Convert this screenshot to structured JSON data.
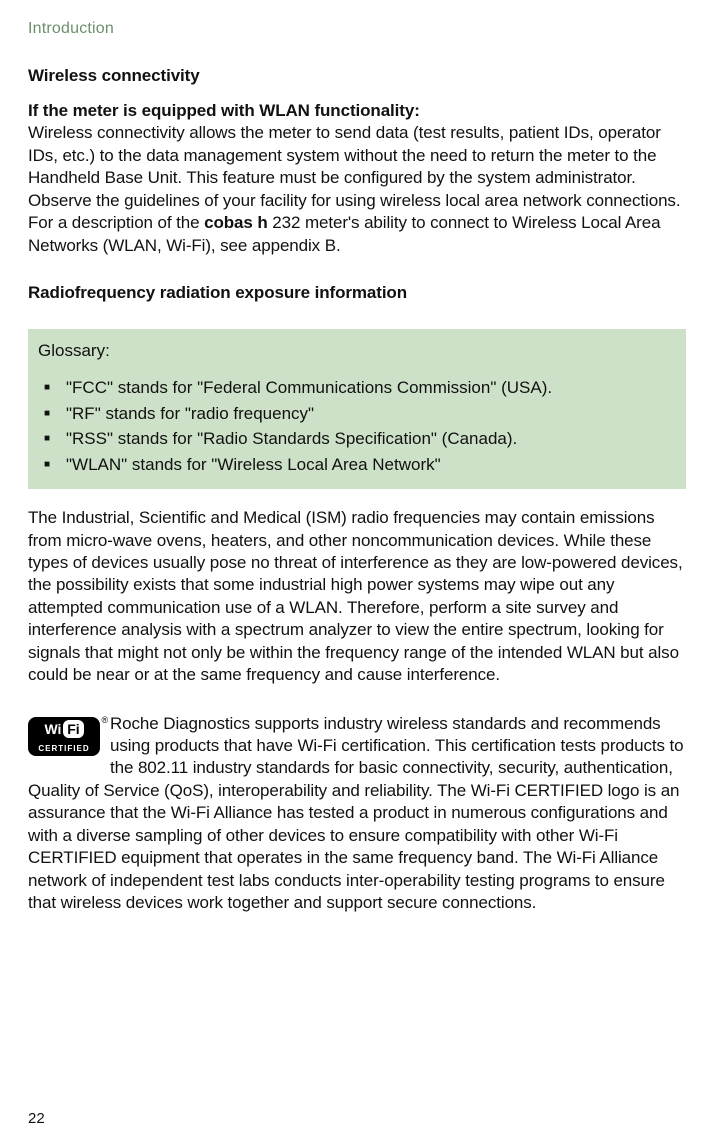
{
  "header": "Introduction",
  "section1_title": "Wireless connectivity",
  "section1_lead": "If the meter is equipped with WLAN functionality:",
  "section1_body_a": "Wireless connectivity allows the meter to send data (test results, patient IDs, operator IDs, etc.) to the data management system without the need to return the meter to the Handheld Base Unit. This feature must be configured by the system administrator. Observe the guidelines of your facility for using wireless local area network connections. For a description of the ",
  "section1_product": "cobas h",
  "section1_product_num": " 232 ",
  "section1_body_b": "meter's ability to connect to Wireless Local Area Networks (WLAN, Wi-Fi), see appendix B.",
  "section2_title": "Radiofrequency radiation exposure information",
  "glossary_title": "Glossary:",
  "glossary_items": [
    "\"FCC\" stands for \"Federal Communications Commission\" (USA).",
    "\"RF\" stands for \"radio frequency\"",
    "\"RSS\" stands for \"Radio Standards Specification\" (Canada).",
    "\"WLAN\" stands for \"Wireless Local Area Network\""
  ],
  "ism_para": "The Industrial, Scientific and Medical (ISM) radio frequencies may contain emissions from micro-wave ovens, heaters, and other noncommunication devices. While these types of devices usually pose no threat of interference as they are low-powered devices, the possibility exists that some industrial high power systems may wipe out any attempted communication use of a WLAN. Therefore, perform a site survey and interference analysis with a spectrum analyzer to view the entire spectrum, looking for signals that might not only be within the frequency range of the intended WLAN but also could be near or at the same frequency and cause interference.",
  "wifi_logo": {
    "wi": "Wi",
    "fi": "Fi",
    "reg": "®",
    "certified": "CERTIFIED"
  },
  "roche_para": "Roche Diagnostics supports industry wireless standards and recommends using products that have Wi-Fi certification. This certification tests products to the 802.11 industry standards for basic connectivity, security, authentication, Quality of Service (QoS), interoperability and reliability. The Wi-Fi CERTIFIED logo is an assurance that the Wi-Fi Alliance has tested a product in numerous configurations and with a diverse sampling of other devices to ensure compatibility with other Wi-Fi CERTIFIED equipment that operates in the same frequency band. The Wi-Fi Alliance network of independent test labs conducts inter-operability testing programs to ensure that wireless devices work together and support secure connections.",
  "page_number": "22"
}
